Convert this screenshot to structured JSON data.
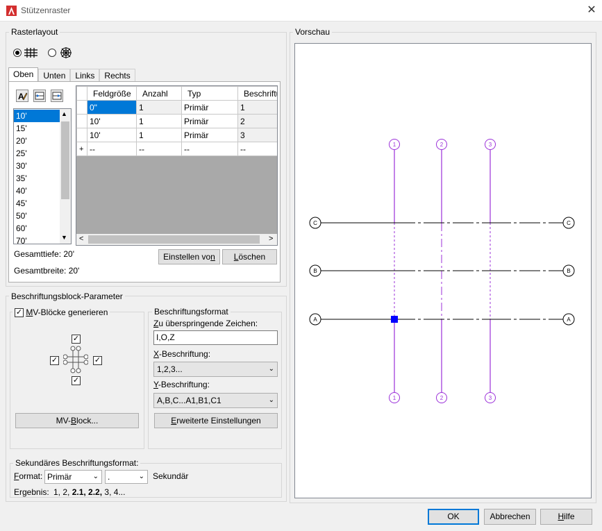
{
  "window": {
    "title": "Stützenraster",
    "close_glyph": "✕"
  },
  "raster": {
    "group_label": "Rasterlayout",
    "tabs": [
      "Oben",
      "Unten",
      "Links",
      "Rechts"
    ],
    "list_items": [
      "10'",
      "15'",
      "20'",
      "25'",
      "30'",
      "35'",
      "40'",
      "45'",
      "50'",
      "60'",
      "70'"
    ],
    "selected_list_index": 0,
    "grid_headers": [
      "Feldgröße",
      "Anzahl",
      "Typ",
      "Beschriftun"
    ],
    "grid_rows": [
      [
        "0\"",
        "1",
        "Primär",
        "1"
      ],
      [
        "10'",
        "1",
        "Primär",
        "2"
      ],
      [
        "10'",
        "1",
        "Primär",
        "3"
      ]
    ],
    "new_row": [
      "--",
      "--",
      "--",
      "--"
    ],
    "new_row_marker": "+",
    "gesamttiefe": "Gesamttiefe: 20'",
    "gesamtbreite": "Gesamtbreite: 20'",
    "einstellen_prefix": "Einstellen vo",
    "einstellen_key": "n",
    "loeschen_key": "L",
    "loeschen_rest": "öschen"
  },
  "beschriftung": {
    "group_label": "Beschriftungsblock-Parameter",
    "mv_checkbox_key": "M",
    "mv_checkbox_rest": "V-Blöcke generieren",
    "mv_block_prefix": "MV-",
    "mv_block_key": "B",
    "mv_block_rest": "lock...",
    "format_group": "Beschriftungsformat",
    "skip_key": "Z",
    "skip_rest": "u überspringende Zeichen:",
    "skip_value": "I,O,Z",
    "x_key": "X",
    "x_rest": "-Beschriftung:",
    "x_value": "1,2,3...",
    "y_key": "Y",
    "y_rest": "-Beschriftung:",
    "y_value": "A,B,C...A1,B1,C1",
    "erweitert_key": "E",
    "erweitert_rest": "rweiterte Einstellungen"
  },
  "sekundaer": {
    "group_label": "Sekundäres Beschriftungsformat:",
    "format_key": "F",
    "format_rest": "ormat:",
    "format_value": "Primär",
    "separator_value": ".",
    "sekundaer_label": "Sekundär",
    "ergebnis_label": "Ergebnis:",
    "ergebnis_plain1": "1, 2,",
    "ergebnis_bold": "2.1, 2.2,",
    "ergebnis_plain2": "3, 4..."
  },
  "preview": {
    "group_label": "Vorschau",
    "col_labels": [
      "1",
      "2",
      "3"
    ],
    "row_labels": [
      "C",
      "B",
      "A"
    ],
    "grid_color": "#9b30d9"
  },
  "footer": {
    "ok": "OK",
    "abbrechen": "Abbrechen",
    "hilfe_key": "H",
    "hilfe_rest": "ilfe"
  }
}
